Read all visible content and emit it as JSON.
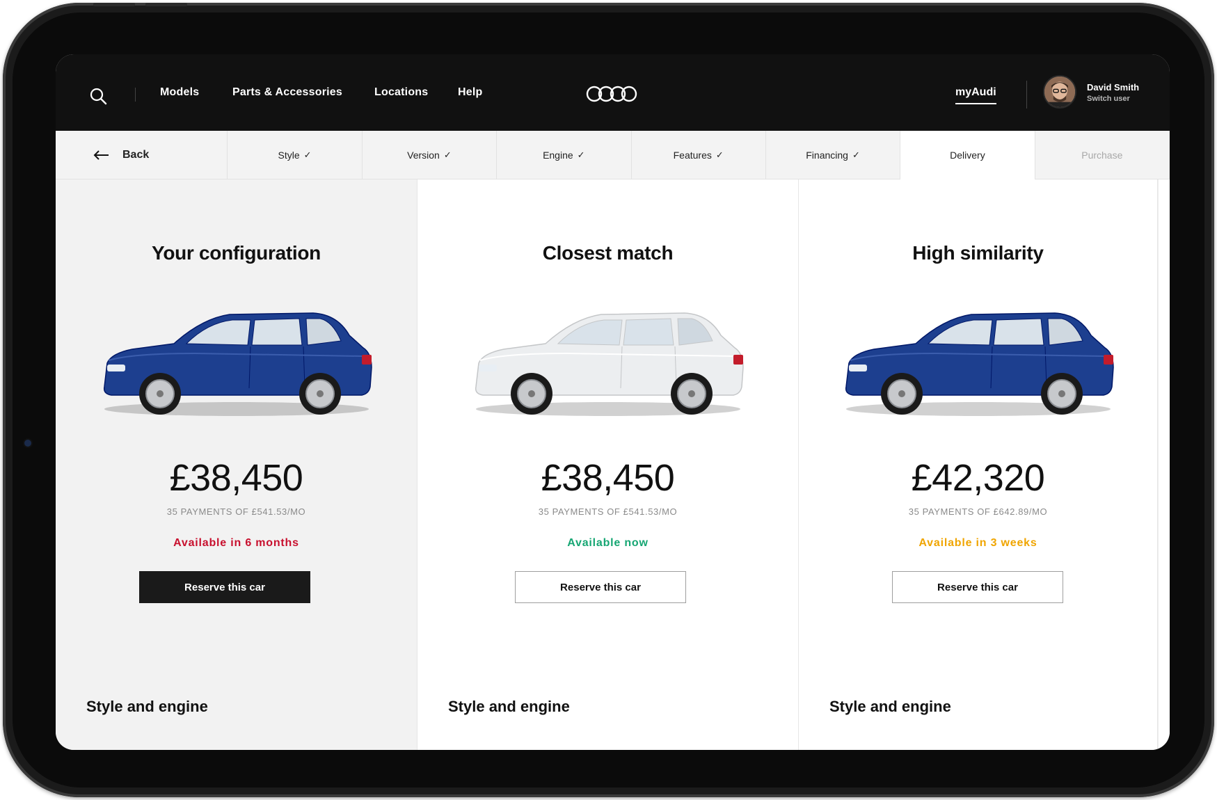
{
  "nav": {
    "items": [
      "Models",
      "Parts & Accessories",
      "Locations",
      "Help"
    ],
    "myaudi_label": "myAudi",
    "user_name": "David Smith",
    "user_switch": "Switch user"
  },
  "steps": {
    "back_label": "Back",
    "items": [
      {
        "label": "Style",
        "check": "✓"
      },
      {
        "label": "Version",
        "check": "✓"
      },
      {
        "label": "Engine",
        "check": "✓"
      },
      {
        "label": "Features",
        "check": "✓"
      },
      {
        "label": "Financing",
        "check": "✓"
      },
      {
        "label": "Delivery",
        "check": ""
      },
      {
        "label": "Purchase",
        "check": ""
      }
    ]
  },
  "cards": [
    {
      "title": "Your configuration",
      "price": "£38,450",
      "payments": "35 PAYMENTS OF £541.53/MO",
      "availability": "Available in 6 months",
      "availability_color": "#c8102e",
      "button_label": "Reserve this car",
      "car_color": "#1d3f8f",
      "section_title": "Style and engine"
    },
    {
      "title": "Closest match",
      "price": "£38,450",
      "payments": "35 PAYMENTS OF £541.53/MO",
      "availability": "Available now",
      "availability_color": "#16a673",
      "button_label": "Reserve this car",
      "car_color": "#eceef0",
      "section_title": "Style and engine"
    },
    {
      "title": "High similarity",
      "price": "£42,320",
      "payments": "35 PAYMENTS OF £642.89/MO",
      "availability": "Available in 3 weeks",
      "availability_color": "#f0a500",
      "button_label": "Reserve this car",
      "car_color": "#1d3f8f",
      "section_title": "Style and engine"
    }
  ],
  "icons": {
    "search": "search-icon",
    "logo": "audi-rings-logo-icon",
    "back": "arrow-left-icon",
    "check": "check-icon"
  }
}
